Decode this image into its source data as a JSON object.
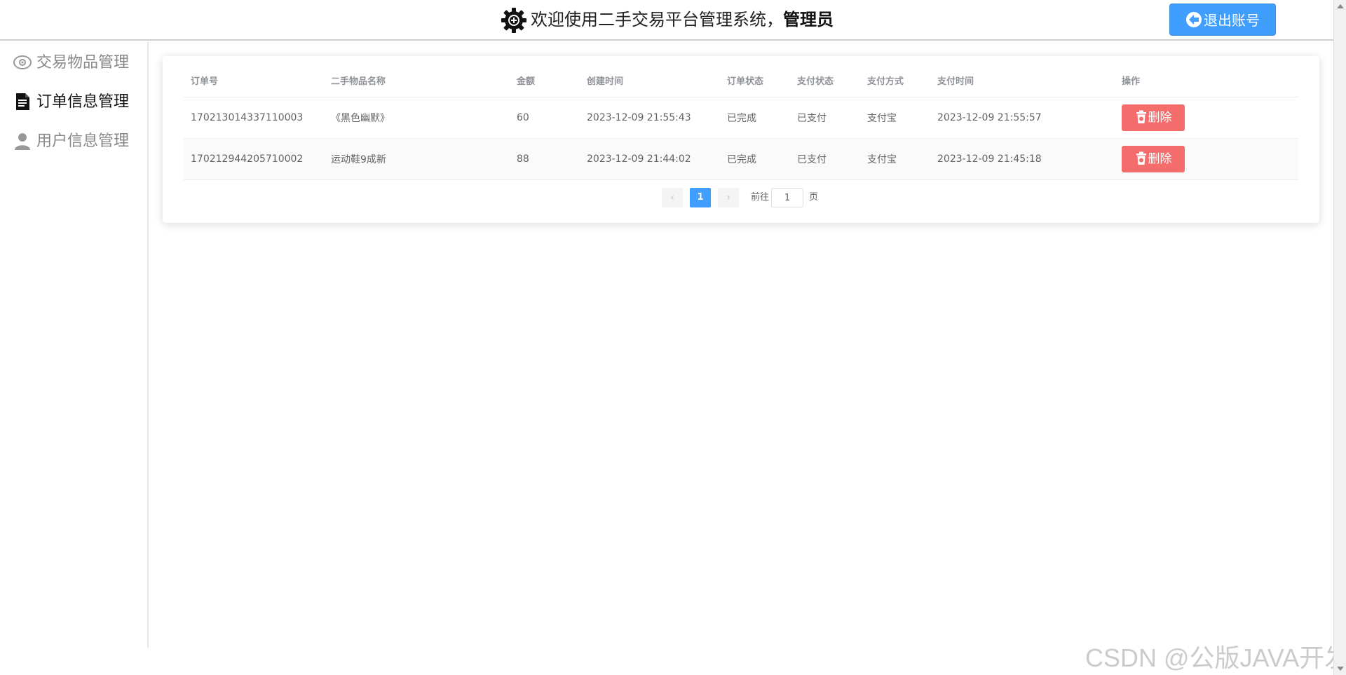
{
  "header": {
    "title": "欢迎使用二手交易平台管理系统，",
    "user": "管理员",
    "logout_label": "退出账号"
  },
  "sidebar": {
    "items": [
      {
        "label": "交易物品管理",
        "icon": "eye-icon",
        "active": false
      },
      {
        "label": "订单信息管理",
        "icon": "document-icon",
        "active": true
      },
      {
        "label": "用户信息管理",
        "icon": "user-icon",
        "active": false
      }
    ]
  },
  "table": {
    "columns": [
      "订单号",
      "二手物品名称",
      "金额",
      "创建时间",
      "订单状态",
      "支付状态",
      "支付方式",
      "支付时间",
      "操作"
    ],
    "rows": [
      {
        "order_no": "170213014337110003",
        "item_name": "《黑色幽默》",
        "amount": "60",
        "created": "2023-12-09 21:55:43",
        "order_status": "已完成",
        "pay_status": "已支付",
        "pay_method": "支付宝",
        "pay_time": "2023-12-09 21:55:57",
        "action": "删除"
      },
      {
        "order_no": "170212944205710002",
        "item_name": "运动鞋9成新",
        "amount": "88",
        "created": "2023-12-09 21:44:02",
        "order_status": "已完成",
        "pay_status": "已支付",
        "pay_method": "支付宝",
        "pay_time": "2023-12-09 21:45:18",
        "action": "删除"
      }
    ]
  },
  "pagination": {
    "prev": "‹",
    "current_page": "1",
    "next": "›",
    "goto_prefix": "前往",
    "goto_value": "1",
    "goto_suffix": "页"
  },
  "watermark": "CSDN @公版JAVA开发",
  "colors": {
    "primary": "#409eff",
    "danger": "#f56c6c"
  }
}
